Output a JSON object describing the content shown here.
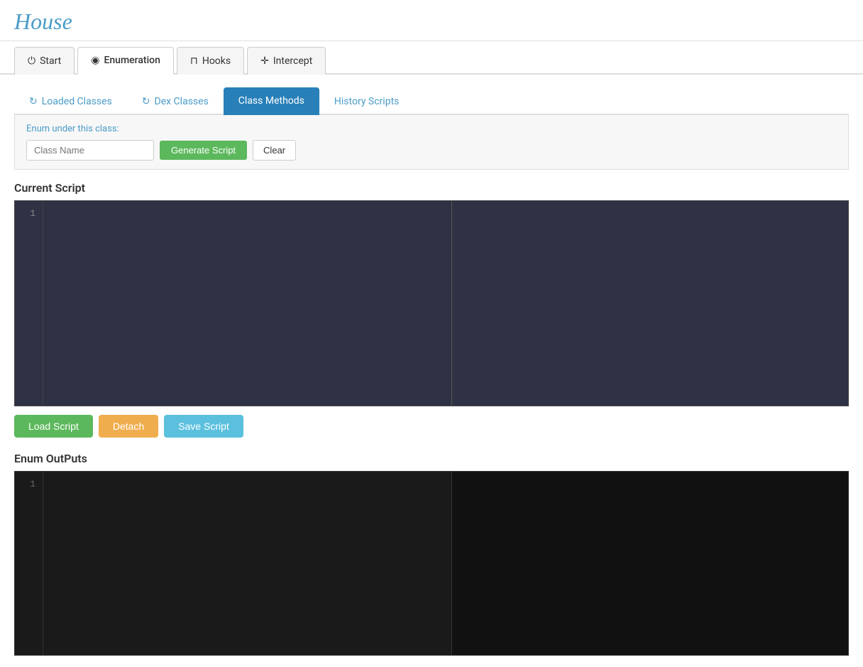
{
  "app": {
    "title": "House"
  },
  "nav": {
    "tabs": [
      {
        "id": "start",
        "label": "Start",
        "icon": "⏻",
        "active": false
      },
      {
        "id": "enumeration",
        "label": "Enumeration",
        "icon": "◉",
        "active": true
      },
      {
        "id": "hooks",
        "label": "Hooks",
        "icon": "⊓",
        "active": false
      },
      {
        "id": "intercept",
        "label": "Intercept",
        "icon": "✛",
        "active": false
      }
    ]
  },
  "subTabs": {
    "tabs": [
      {
        "id": "loaded-classes",
        "label": "Loaded Classes",
        "icon": "↻",
        "active": false
      },
      {
        "id": "dex-classes",
        "label": "Dex Classes",
        "icon": "↻",
        "active": false
      },
      {
        "id": "class-methods",
        "label": "Class Methods",
        "icon": "",
        "active": true
      },
      {
        "id": "history-scripts",
        "label": "History Scripts",
        "icon": "",
        "active": false
      }
    ]
  },
  "enumPanel": {
    "label": "Enum under this class:",
    "placeholder": "Class Name",
    "generateLabel": "Generate Script",
    "clearLabel": "Clear"
  },
  "currentScript": {
    "title": "Current Script",
    "lineNumber": "1"
  },
  "buttons": {
    "loadScript": "Load Script",
    "detach": "Detach",
    "saveScript": "Save Script"
  },
  "enumOutputs": {
    "title": "Enum OutPuts",
    "lineNumber": "1"
  }
}
